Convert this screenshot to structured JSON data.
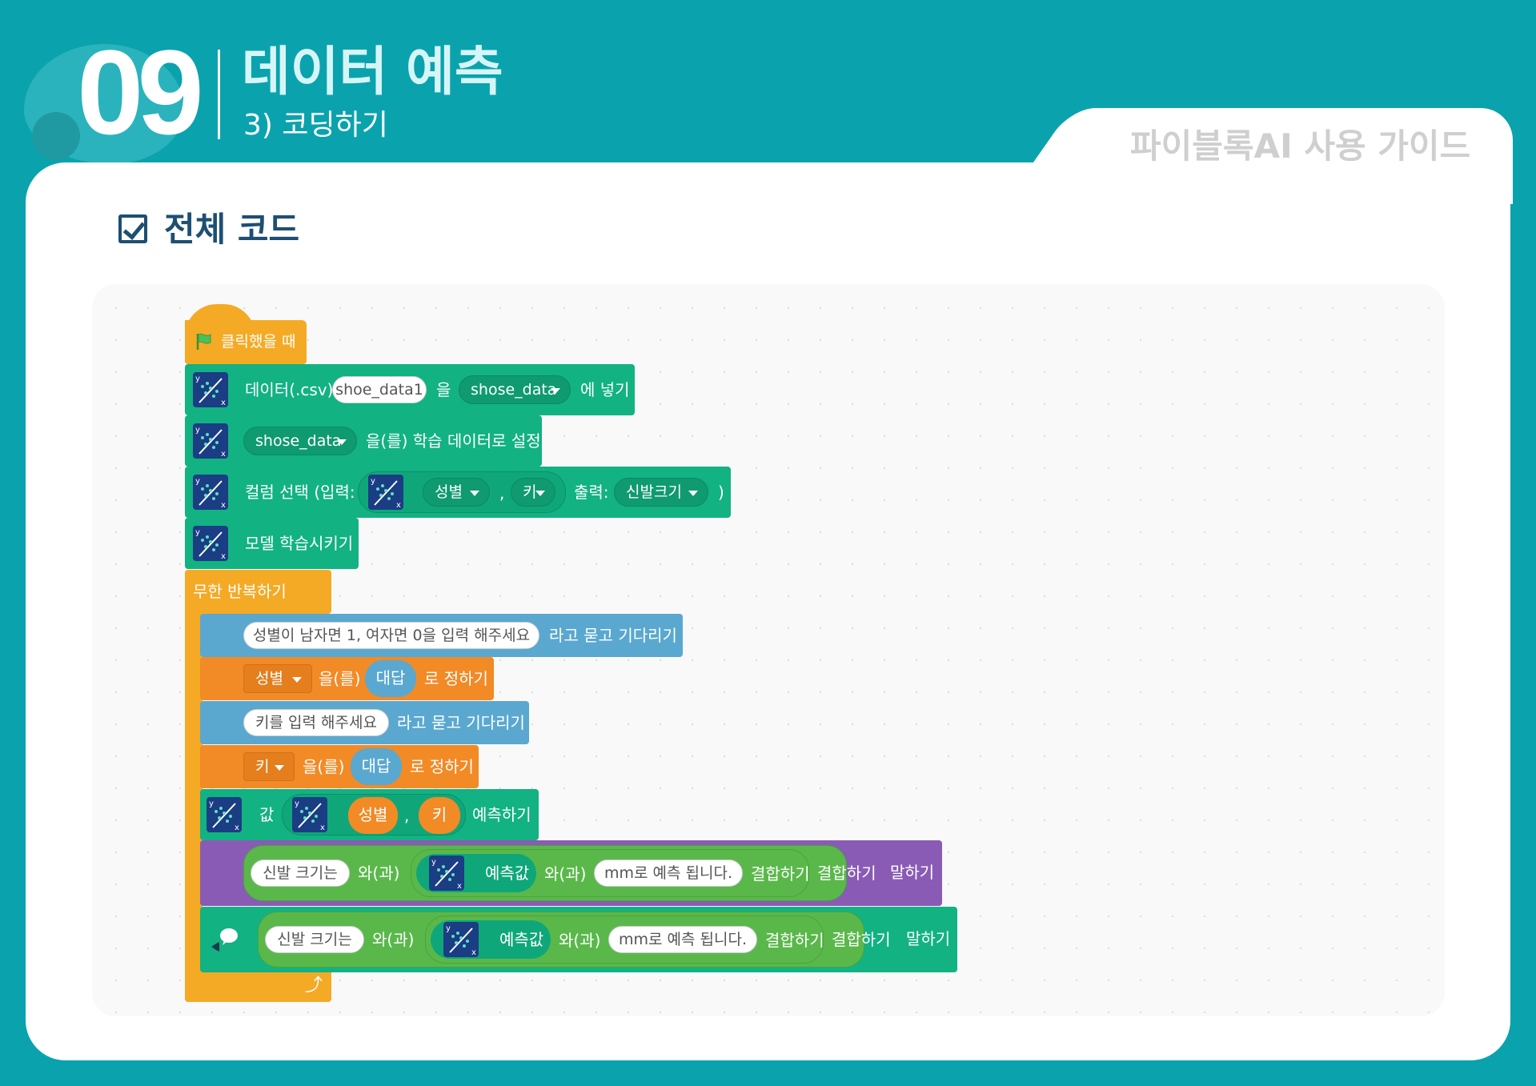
{
  "header": {
    "number": "09",
    "title": "데이터 예측",
    "subtitle": "3) 코딩하기",
    "guide_tab": "파이블록AI 사용 가이드"
  },
  "section": {
    "title": "전체 코드"
  },
  "blocks": {
    "hat": "클릭했을 때",
    "b1": {
      "t1": "데이터(.csv)",
      "v1": "shoe_data1",
      "t2": "을",
      "d1": "shose_data",
      "t3": "에 넣기"
    },
    "b2": {
      "d1": "shose_data",
      "t1": "을(를) 학습 데이터로 설정"
    },
    "b3": {
      "t1": "컬럼 선택 (입력:",
      "d1": "성별",
      "comma": ",",
      "d2": "키",
      "t2": "출력:",
      "d3": "신발크기",
      "t3": ")"
    },
    "b4": {
      "t1": "모델 학습시키기"
    },
    "loop": {
      "t1": "무한 반복하기"
    },
    "b5": {
      "v1": "성별이 남자면 1, 여자면 0을 입력 해주세요",
      "t1": "라고 묻고 기다리기"
    },
    "b6": {
      "d1": "성별",
      "t1": "을(를)",
      "r1": "대답",
      "t2": "로 정하기"
    },
    "b7": {
      "v1": "키를 입력 해주세요",
      "t1": "라고 묻고 기다리기"
    },
    "b8": {
      "d1": "키",
      "t1": "을(를)",
      "r1": "대답",
      "t2": "로 정하기"
    },
    "b9": {
      "t1": "값",
      "r1": "성별",
      "comma": ",",
      "r2": "키",
      "t2": "예측하기"
    },
    "b10": {
      "v1": "신발 크기는",
      "t1": "와(과)",
      "r1": "예측값",
      "t2": "와(과)",
      "v2": "mm로 예측 됩니다.",
      "t3": "결합하기",
      "t4": "결합하기",
      "t5": "말하기"
    },
    "b11": {
      "v1": "신발 크기는",
      "t1": "와(과)",
      "r1": "예측값",
      "t2": "와(과)",
      "v2": "mm로 예측 됩니다.",
      "t3": "결합하기",
      "t4": "결합하기",
      "t5": "말하기"
    }
  },
  "icons": [
    "flag-icon",
    "ai-model-icon",
    "speech-bubble-icon",
    "loop-arrow-icon"
  ],
  "colors": {
    "background": "#0aa3ad",
    "teal_block": "#12b283",
    "event_block": "#f4aa25",
    "sensing_block": "#5aa8d0",
    "variable_block": "#f28a26",
    "looks_block": "#8a5bb5",
    "operator_block": "#5ab84b"
  }
}
